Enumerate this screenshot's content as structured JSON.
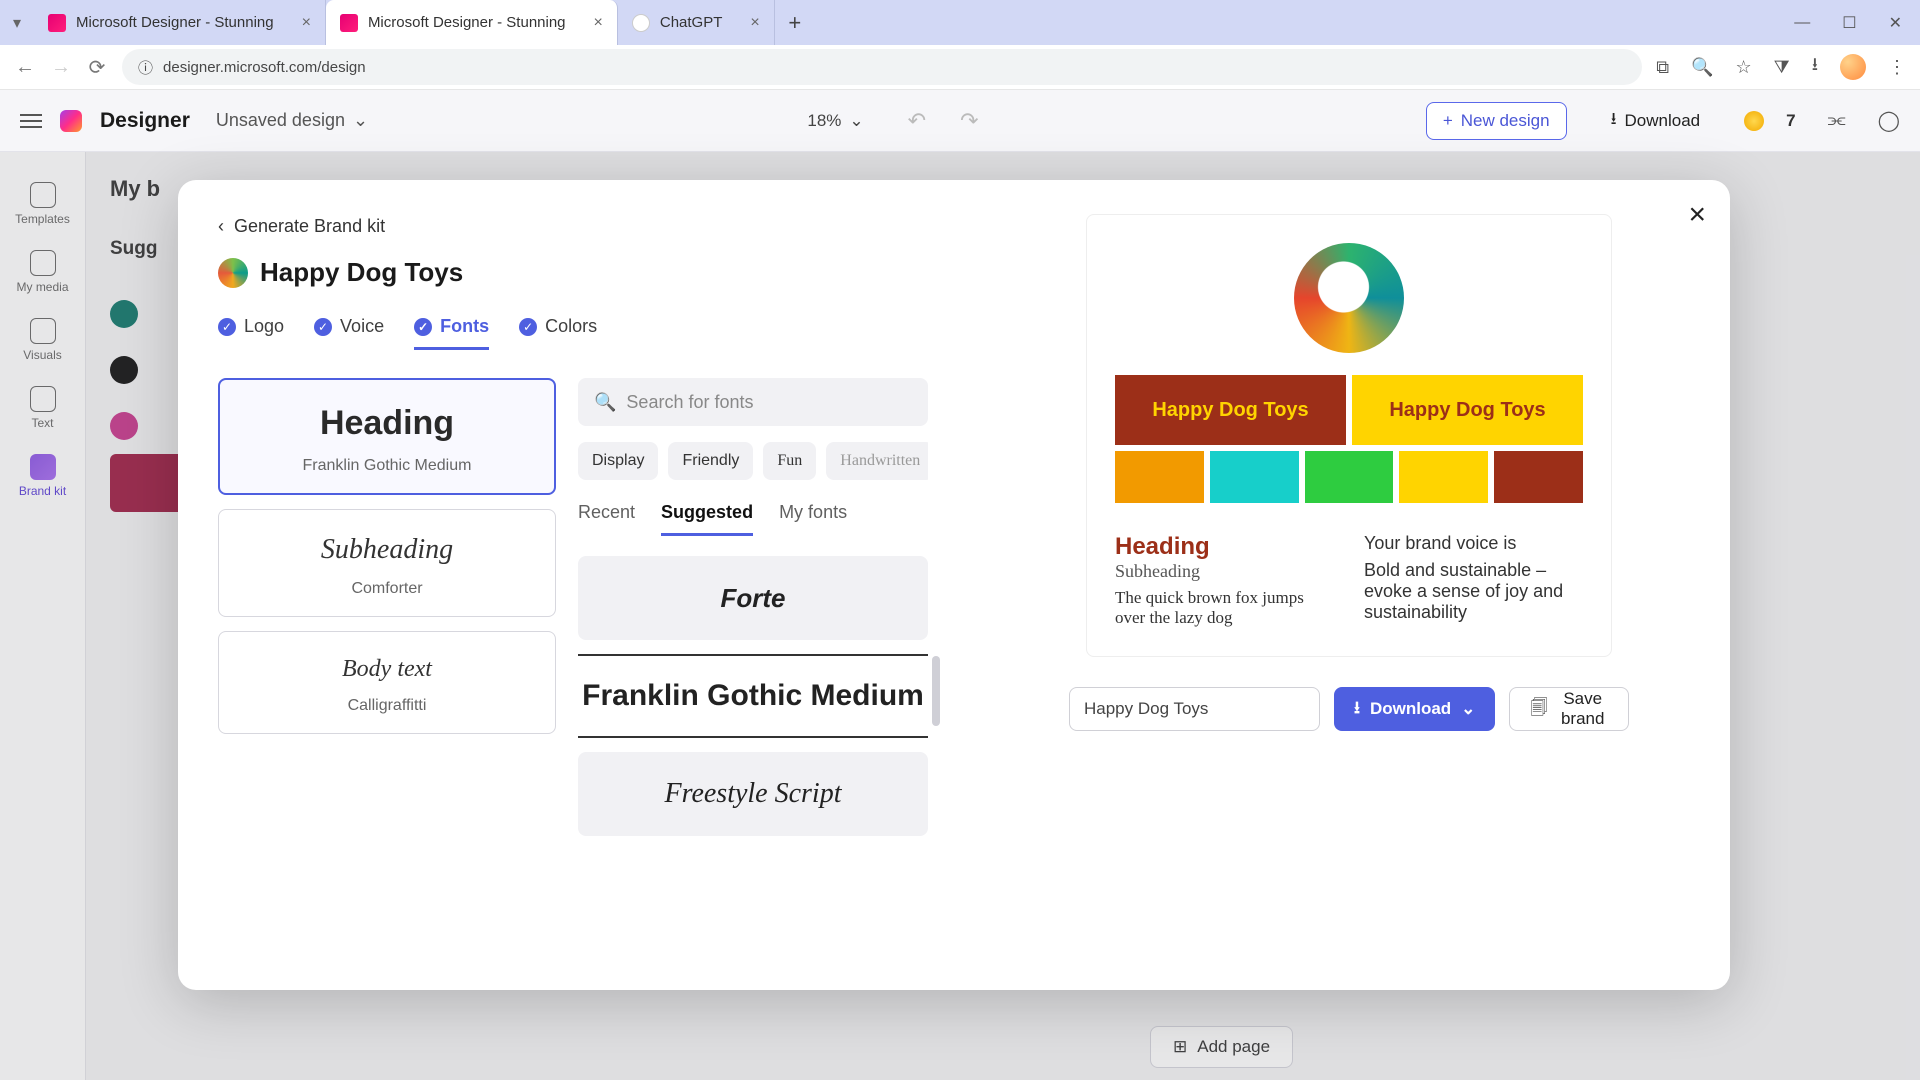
{
  "browser": {
    "tabs": [
      {
        "title": "Microsoft Designer - Stunning",
        "fav": "fav-designer"
      },
      {
        "title": "Microsoft Designer - Stunning",
        "fav": "fav-designer"
      },
      {
        "title": "ChatGPT",
        "fav": "fav-chatgpt"
      }
    ],
    "url": "designer.microsoft.com/design"
  },
  "appheader": {
    "brand": "Designer",
    "design_name": "Unsaved design",
    "zoom": "18%",
    "new_design": "New design",
    "download": "Download",
    "credits": "7"
  },
  "leftrail": [
    "Templates",
    "My media",
    "Visuals",
    "Text",
    "Brand kit"
  ],
  "background": {
    "panel_title": "My b",
    "section": "Sugg"
  },
  "addpage": "Add page",
  "modal": {
    "back": "Generate Brand kit",
    "brand_name": "Happy Dog Toys",
    "tabs": [
      "Logo",
      "Voice",
      "Fonts",
      "Colors"
    ],
    "active_tab": "Fonts",
    "slots": [
      {
        "role": "Heading",
        "font": "Franklin Gothic Medium"
      },
      {
        "role": "Subheading",
        "font": "Comforter"
      },
      {
        "role": "Body text",
        "font": "Calligraffitti"
      }
    ],
    "search_placeholder": "Search for fonts",
    "chips": [
      "Display",
      "Friendly",
      "Fun",
      "Handwritten"
    ],
    "subtabs": [
      "Recent",
      "Suggested",
      "My fonts"
    ],
    "active_subtab": "Suggested",
    "font_list": [
      "Forte",
      "Franklin Gothic Medium",
      "Freestyle Script"
    ],
    "selected_font": "Franklin Gothic Medium"
  },
  "preview": {
    "band_text": "Happy Dog Toys",
    "palette": [
      "#f29a00",
      "#17cfca",
      "#2ecc40",
      "#ffd400",
      "#9c2f18"
    ],
    "heading": "Heading",
    "subheading": "Subheading",
    "body": "The quick brown fox jumps over the lazy dog",
    "voice_label": "Your brand voice is",
    "voice_body": "Bold and sustainable – evoke a sense of joy and sustainability"
  },
  "actions": {
    "name_value": "Happy Dog Toys",
    "download": "Download",
    "save": "Save brand"
  }
}
